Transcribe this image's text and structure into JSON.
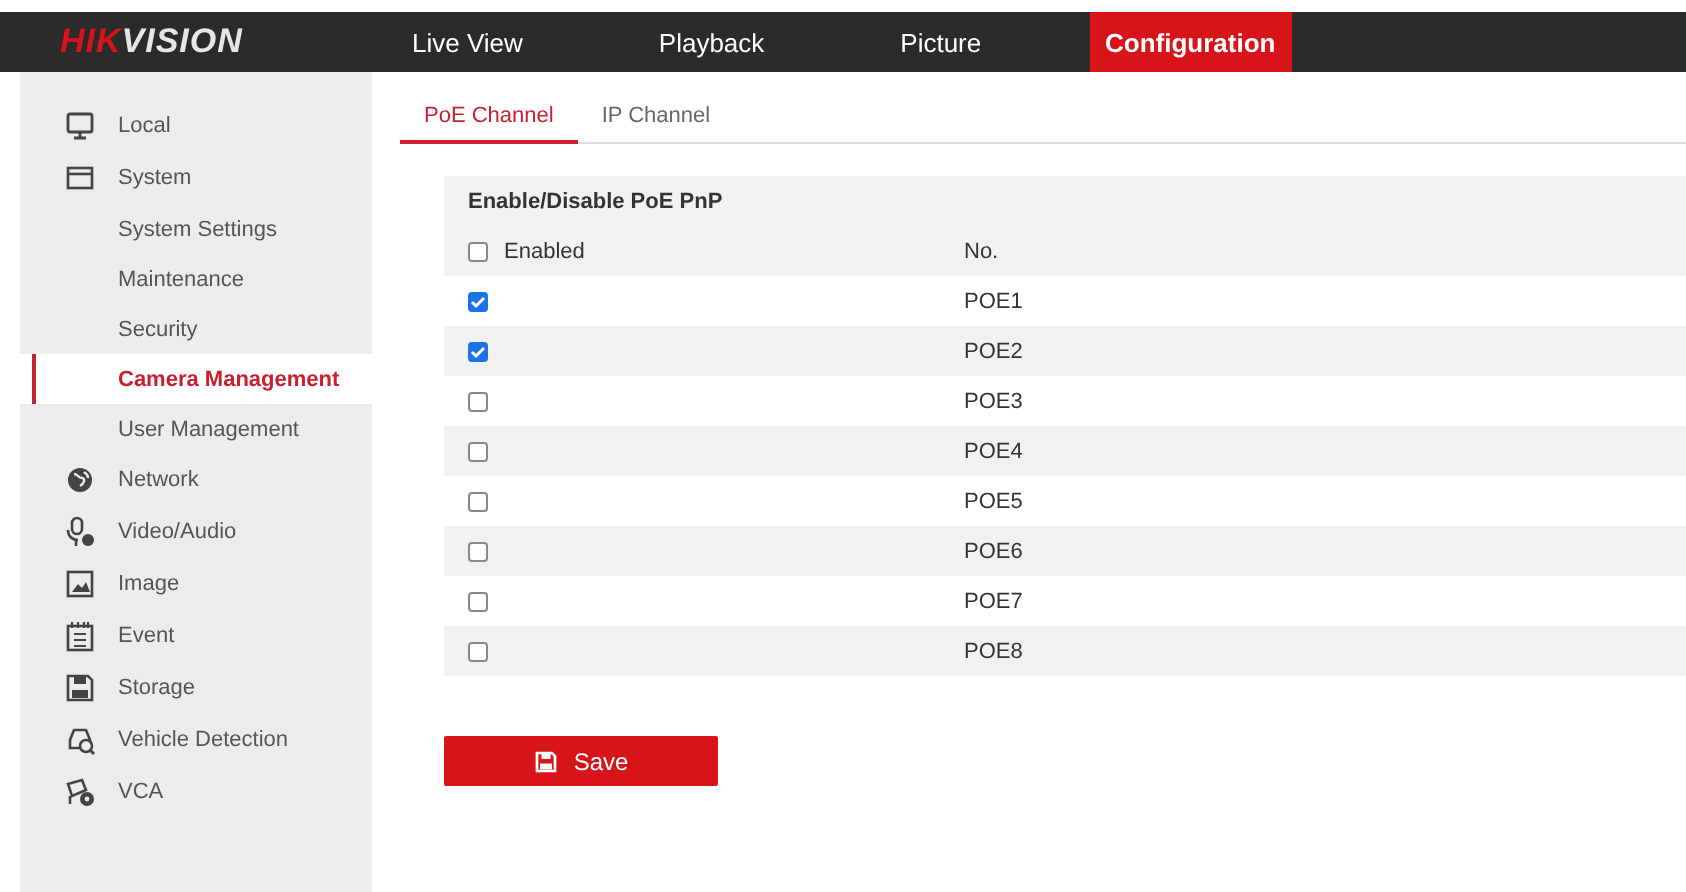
{
  "logo": {
    "prefix": "HIK",
    "suffix": "VISION"
  },
  "nav": [
    {
      "label": "Live View",
      "selected": false
    },
    {
      "label": "Playback",
      "selected": false
    },
    {
      "label": "Picture",
      "selected": false
    },
    {
      "label": "Configuration",
      "selected": true
    }
  ],
  "sidebar": {
    "items": [
      {
        "label": "Local",
        "selected": false
      },
      {
        "label": "System",
        "selected": false,
        "children": [
          {
            "label": "System Settings",
            "selected": false
          },
          {
            "label": "Maintenance",
            "selected": false
          },
          {
            "label": "Security",
            "selected": false
          },
          {
            "label": "Camera Management",
            "selected": true
          },
          {
            "label": "User Management",
            "selected": false
          }
        ]
      },
      {
        "label": "Network",
        "selected": false
      },
      {
        "label": "Video/Audio",
        "selected": false
      },
      {
        "label": "Image",
        "selected": false
      },
      {
        "label": "Event",
        "selected": false
      },
      {
        "label": "Storage",
        "selected": false
      },
      {
        "label": "Vehicle Detection",
        "selected": false
      },
      {
        "label": "VCA",
        "selected": false
      }
    ]
  },
  "tabs": [
    {
      "label": "PoE Channel",
      "selected": true
    },
    {
      "label": "IP Channel",
      "selected": false
    }
  ],
  "table": {
    "title": "Enable/Disable PoE PnP",
    "header": {
      "enabled_label": "Enabled",
      "checked": false,
      "no_label": "No."
    },
    "rows": [
      {
        "checked": true,
        "no": "POE1"
      },
      {
        "checked": true,
        "no": "POE2"
      },
      {
        "checked": false,
        "no": "POE3"
      },
      {
        "checked": false,
        "no": "POE4"
      },
      {
        "checked": false,
        "no": "POE5"
      },
      {
        "checked": false,
        "no": "POE6"
      },
      {
        "checked": false,
        "no": "POE7"
      },
      {
        "checked": false,
        "no": "POE8"
      }
    ]
  },
  "save_button": {
    "label": "Save"
  }
}
